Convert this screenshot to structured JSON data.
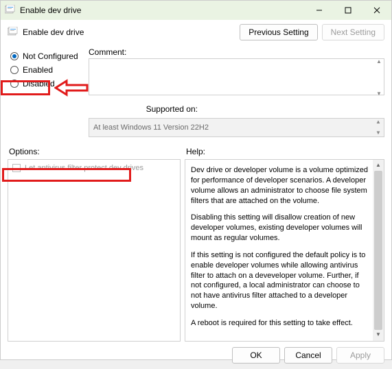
{
  "window": {
    "title": "Enable dev drive",
    "minimize": "—",
    "maximize": "▢",
    "close": "✕"
  },
  "header": {
    "policy_name": "Enable dev drive",
    "previous": "Previous Setting",
    "next": "Next Setting"
  },
  "state": {
    "not_configured": "Not Configured",
    "enabled": "Enabled",
    "disabled": "Disabled",
    "selected": "not_configured"
  },
  "fields": {
    "comment_label": "Comment:",
    "comment_value": "",
    "supported_label": "Supported on:",
    "supported_value": "At least Windows 11 Version 22H2"
  },
  "sections": {
    "options": "Options:",
    "help": "Help:"
  },
  "options": {
    "antivirus_checkbox": "Let antivirus filter protect dev drives"
  },
  "help": {
    "p1": "Dev drive or developer volume is a volume optimized for performance of developer scenarios. A developer volume allows an administrator to choose file system filters that are attached on the volume.",
    "p2": "Disabling this setting will disallow creation of new developer volumes, existing developer volumes will mount as regular volumes.",
    "p3": "If this setting is not configured the default policy is to enable developer volumes while allowing antivirus filter to attach on a deveveloper volume.  Further, if not configured, a local administrator can choose to not have antivirus filter attached to a developer volume.",
    "p4": "A reboot is required for this setting to take effect."
  },
  "buttons": {
    "ok": "OK",
    "cancel": "Cancel",
    "apply": "Apply"
  }
}
